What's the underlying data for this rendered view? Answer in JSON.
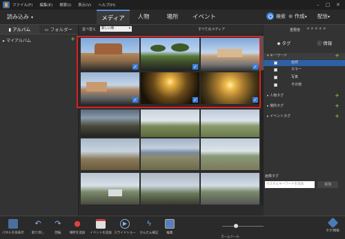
{
  "menubar": {
    "items": [
      "ファイル(F)",
      "編集(E)",
      "検索(I)",
      "表示(V)",
      "ヘルプ(H)"
    ]
  },
  "titlebar": {
    "import_label": "読み込み",
    "tabs": [
      "メディア",
      "人物",
      "場所",
      "イベント"
    ],
    "active_tab": "メディア",
    "search_label": "検索",
    "create_label": "作成",
    "share_label": "配信"
  },
  "left_panel": {
    "tab_album": "アルバム",
    "tab_folder": "フォルダー",
    "my_albums": "マイアルバム"
  },
  "toolbar": {
    "sort_label": "並べ替え",
    "sort_value": "新しい順",
    "all_media": "すべてのメディア"
  },
  "right_panel": {
    "rating_label": "重要度",
    "stars": "★★★★★",
    "tab_tags": "タグ",
    "tab_info": "情報",
    "keywords_label": "キーワード",
    "keyword_items": [
      "自然",
      "カラー",
      "写真",
      "その他"
    ],
    "people_tags": "人物タグ",
    "place_tags": "場所タグ",
    "event_tags": "イベントタグ",
    "assign_label": "画像タグ",
    "assign_placeholder": "カスタムキーワードを追加",
    "assign_button": "追加"
  },
  "bottom_bar": {
    "items": [
      "パネルを非表示",
      "取り消し",
      "回転",
      "場所を追加",
      "イベントを追加",
      "スライドショー",
      "かんたん補正",
      "編集"
    ],
    "zoom_label": "ズームツール",
    "tags_info": "タグ/情報"
  },
  "colors": {
    "accent": "#3b7dd8",
    "selection": "#e02020",
    "add": "#6fbf3a"
  }
}
